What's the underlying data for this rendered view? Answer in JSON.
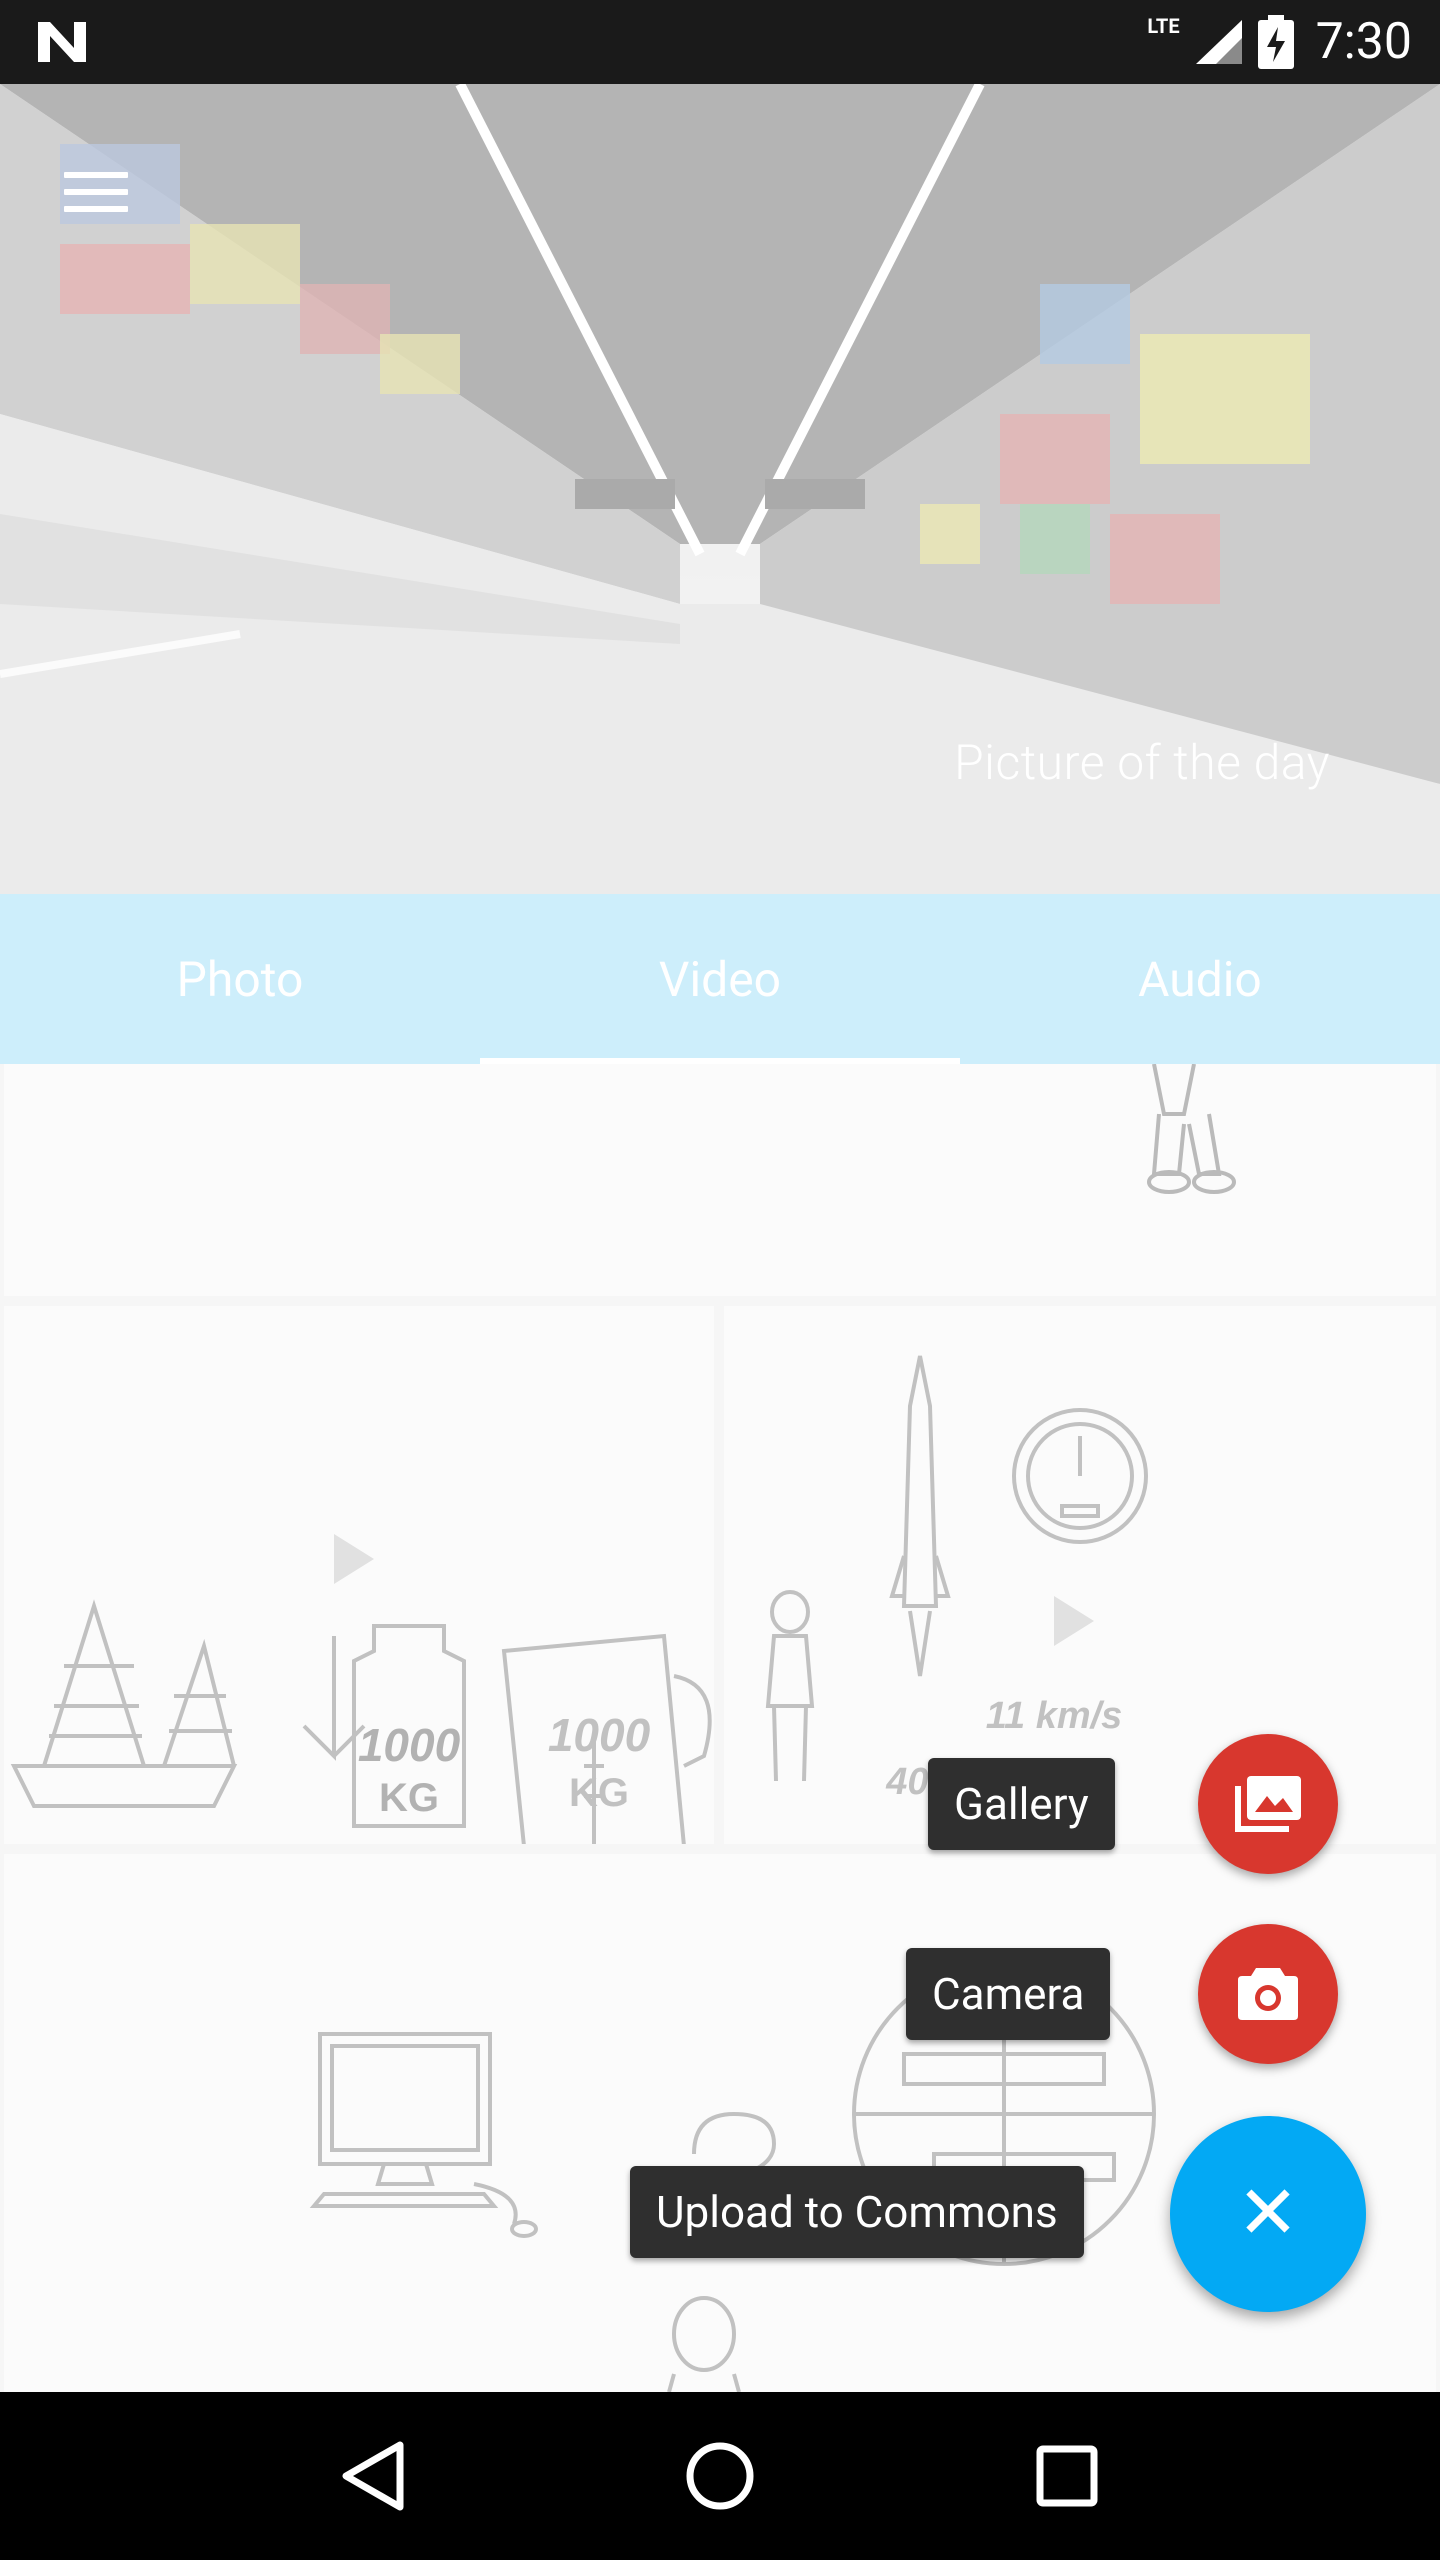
{
  "status_bar": {
    "network": "LTE",
    "time": "7:30"
  },
  "header": {
    "caption": "Picture of the day",
    "menu_icon": "hamburger-menu-icon"
  },
  "tabs": [
    {
      "label": "Photo",
      "active": false
    },
    {
      "label": "Video",
      "active": true
    },
    {
      "label": "Audio",
      "active": false
    }
  ],
  "tiles": {
    "rocket_speed_1": "11 km/s",
    "rocket_speed_2": "40.000 km/h",
    "weight_label": "1000",
    "weight_unit": "KG",
    "play_icon": "play-icon"
  },
  "fab": {
    "gallery_label": "Gallery",
    "camera_label": "Camera",
    "upload_label": "Upload to Commons",
    "close_symbol": "✕",
    "gallery_color": "#d8372e",
    "camera_color": "#d8372e",
    "main_color": "#03a9f4"
  },
  "nav": {
    "back_icon": "back-triangle-icon",
    "home_icon": "home-circle-icon",
    "recents_icon": "recents-square-icon"
  }
}
